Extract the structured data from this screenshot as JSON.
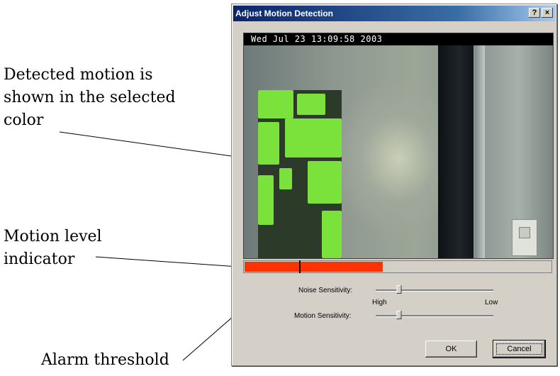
{
  "annotations": {
    "detected_motion": [
      "Detected motion is",
      "shown in the selected",
      "color"
    ],
    "motion_level": [
      "Motion level",
      "indicator"
    ],
    "alarm_threshold": "Alarm threshold"
  },
  "dialog": {
    "title": "Adjust Motion Detection",
    "help_button": "?",
    "close_button": "×",
    "timestamp": "Wed Jul 23  13:09:58  2003",
    "motion_level": 0.45,
    "alarm_threshold": 0.18,
    "colors": {
      "motion": "#7be23c",
      "level_bar": "#ff3300"
    },
    "noise_sensitivity": {
      "label": "Noise Sensitivity:",
      "value": 0.2
    },
    "scale_high": "High",
    "scale_low": "Low",
    "motion_sensitivity": {
      "label": "Motion Sensitivity:",
      "value": 0.2
    },
    "ok_label": "OK",
    "cancel_label": "Cancel"
  }
}
